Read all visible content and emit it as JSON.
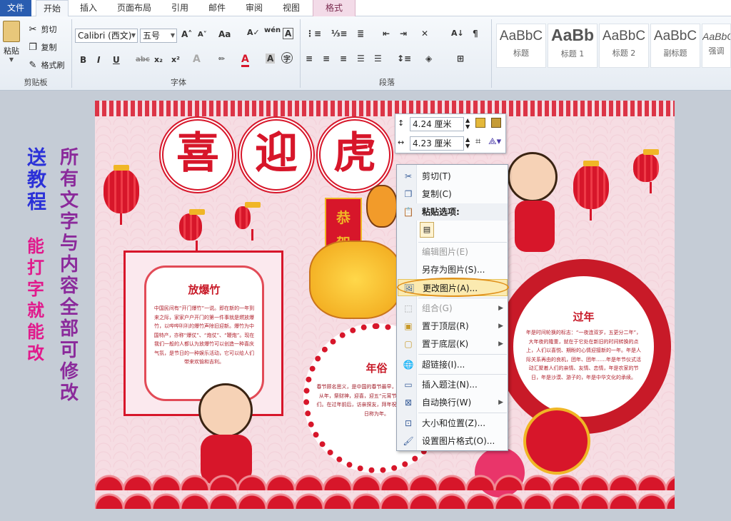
{
  "tabs": [
    "文件",
    "开始",
    "插入",
    "页面布局",
    "引用",
    "邮件",
    "审阅",
    "视图",
    "格式"
  ],
  "clipboard": {
    "paste": "粘贴",
    "cut": "剪切",
    "copy": "复制",
    "format_painter": "格式刷",
    "group_label": "剪贴板"
  },
  "font": {
    "name": "Calibri (西文)",
    "size": "五号",
    "group_label": "字体"
  },
  "paragraph": {
    "group_label": "段落"
  },
  "styles": [
    {
      "preview": "AaBbC",
      "label": "标题"
    },
    {
      "preview": "AaBb",
      "label": "标题 1"
    },
    {
      "preview": "AaBbC",
      "label": "标题 2"
    },
    {
      "preview": "AaBbC",
      "label": "副标题"
    },
    {
      "preview": "AaBbC",
      "label": "强调"
    }
  ],
  "document": {
    "title_chars": [
      "喜",
      "迎",
      "虎"
    ],
    "scroll_text": "恭",
    "scroll_text2": "贺",
    "left_panel": {
      "title": "放爆竹",
      "body": "中国民间有“开门爆竹”一说。即在新的一年到来之际，家家户户开门的第一件事就是燃放爆竹，以哔哔叭叭的爆竹声除旧迎新。爆竹为中国特产，亦称“爆仗”、“炮仗”、“鞭炮”。现在我们一般的人都认为放爆竹可以创造一种喜庆气氛，是节日的一种娱乐活动，它可以给人们带来欢愉和吉利。"
    },
    "right_panel": {
      "title": "过年",
      "body": "年是时间轮换的标志：“一夜连双岁，五更分二年”，大年夜的隆重，就在于它处在新旧的时间转换的点上，人们以喜悦、期盼的心情迎接新的一年。年是人际关系再由的良机，团年、团年……年是年节仪式活动汇聚着人们的亲情、友情、恋情，年是农家的节日，年是沙漠、游子的，年是中华文化的承续。"
    },
    "mid_panel": {
      "title": "年俗",
      "body": "春节顾名思义，是中国的春节最早，中国民间过年都是从年，祭财神，迎喜，迎五“元宵节”结束，所有的人们。在过年前后，访亲探友，拜年祝福年的。始设的节日称为年。"
    },
    "hint_blue": "送教程",
    "hint_pink": "能打字就能改",
    "hint_purple": "所有文字与内容全部可修改"
  },
  "size_toolbar": {
    "height": "4.24 厘米",
    "width": "4.23 厘米"
  },
  "context_menu": {
    "items": [
      {
        "label": "剪切(T)",
        "icon": "scissors-icon",
        "disabled": false,
        "submenu": false
      },
      {
        "label": "复制(C)",
        "icon": "copy-icon",
        "disabled": false,
        "submenu": false
      },
      {
        "label": "粘贴选项:",
        "icon": "paste-icon",
        "disabled": false,
        "submenu": false
      },
      {
        "label": "编辑图片(E)",
        "icon": "",
        "disabled": true,
        "submenu": false
      },
      {
        "label": "另存为图片(S)...",
        "icon": "",
        "disabled": false,
        "submenu": false
      },
      {
        "label": "更改图片(A)...",
        "icon": "change-picture-icon",
        "disabled": false,
        "submenu": false,
        "highlighted": true
      },
      {
        "label": "组合(G)",
        "icon": "group-icon",
        "disabled": true,
        "submenu": true
      },
      {
        "label": "置于顶层(R)",
        "icon": "bring-front-icon",
        "disabled": false,
        "submenu": true
      },
      {
        "label": "置于底层(K)",
        "icon": "send-back-icon",
        "disabled": false,
        "submenu": true
      },
      {
        "label": "超链接(I)...",
        "icon": "hyperlink-icon",
        "disabled": false,
        "submenu": false
      },
      {
        "label": "插入题注(N)...",
        "icon": "caption-icon",
        "disabled": false,
        "submenu": false
      },
      {
        "label": "自动换行(W)",
        "icon": "wrap-text-icon",
        "disabled": false,
        "submenu": true
      },
      {
        "label": "大小和位置(Z)...",
        "icon": "size-position-icon",
        "disabled": false,
        "submenu": false
      },
      {
        "label": "设置图片格式(O)...",
        "icon": "format-picture-icon",
        "disabled": false,
        "submenu": false
      }
    ]
  },
  "colors": {
    "accent_red": "#d7162a",
    "file_tab": "#2a5db0",
    "menu_highlight": "#fbeab0"
  }
}
